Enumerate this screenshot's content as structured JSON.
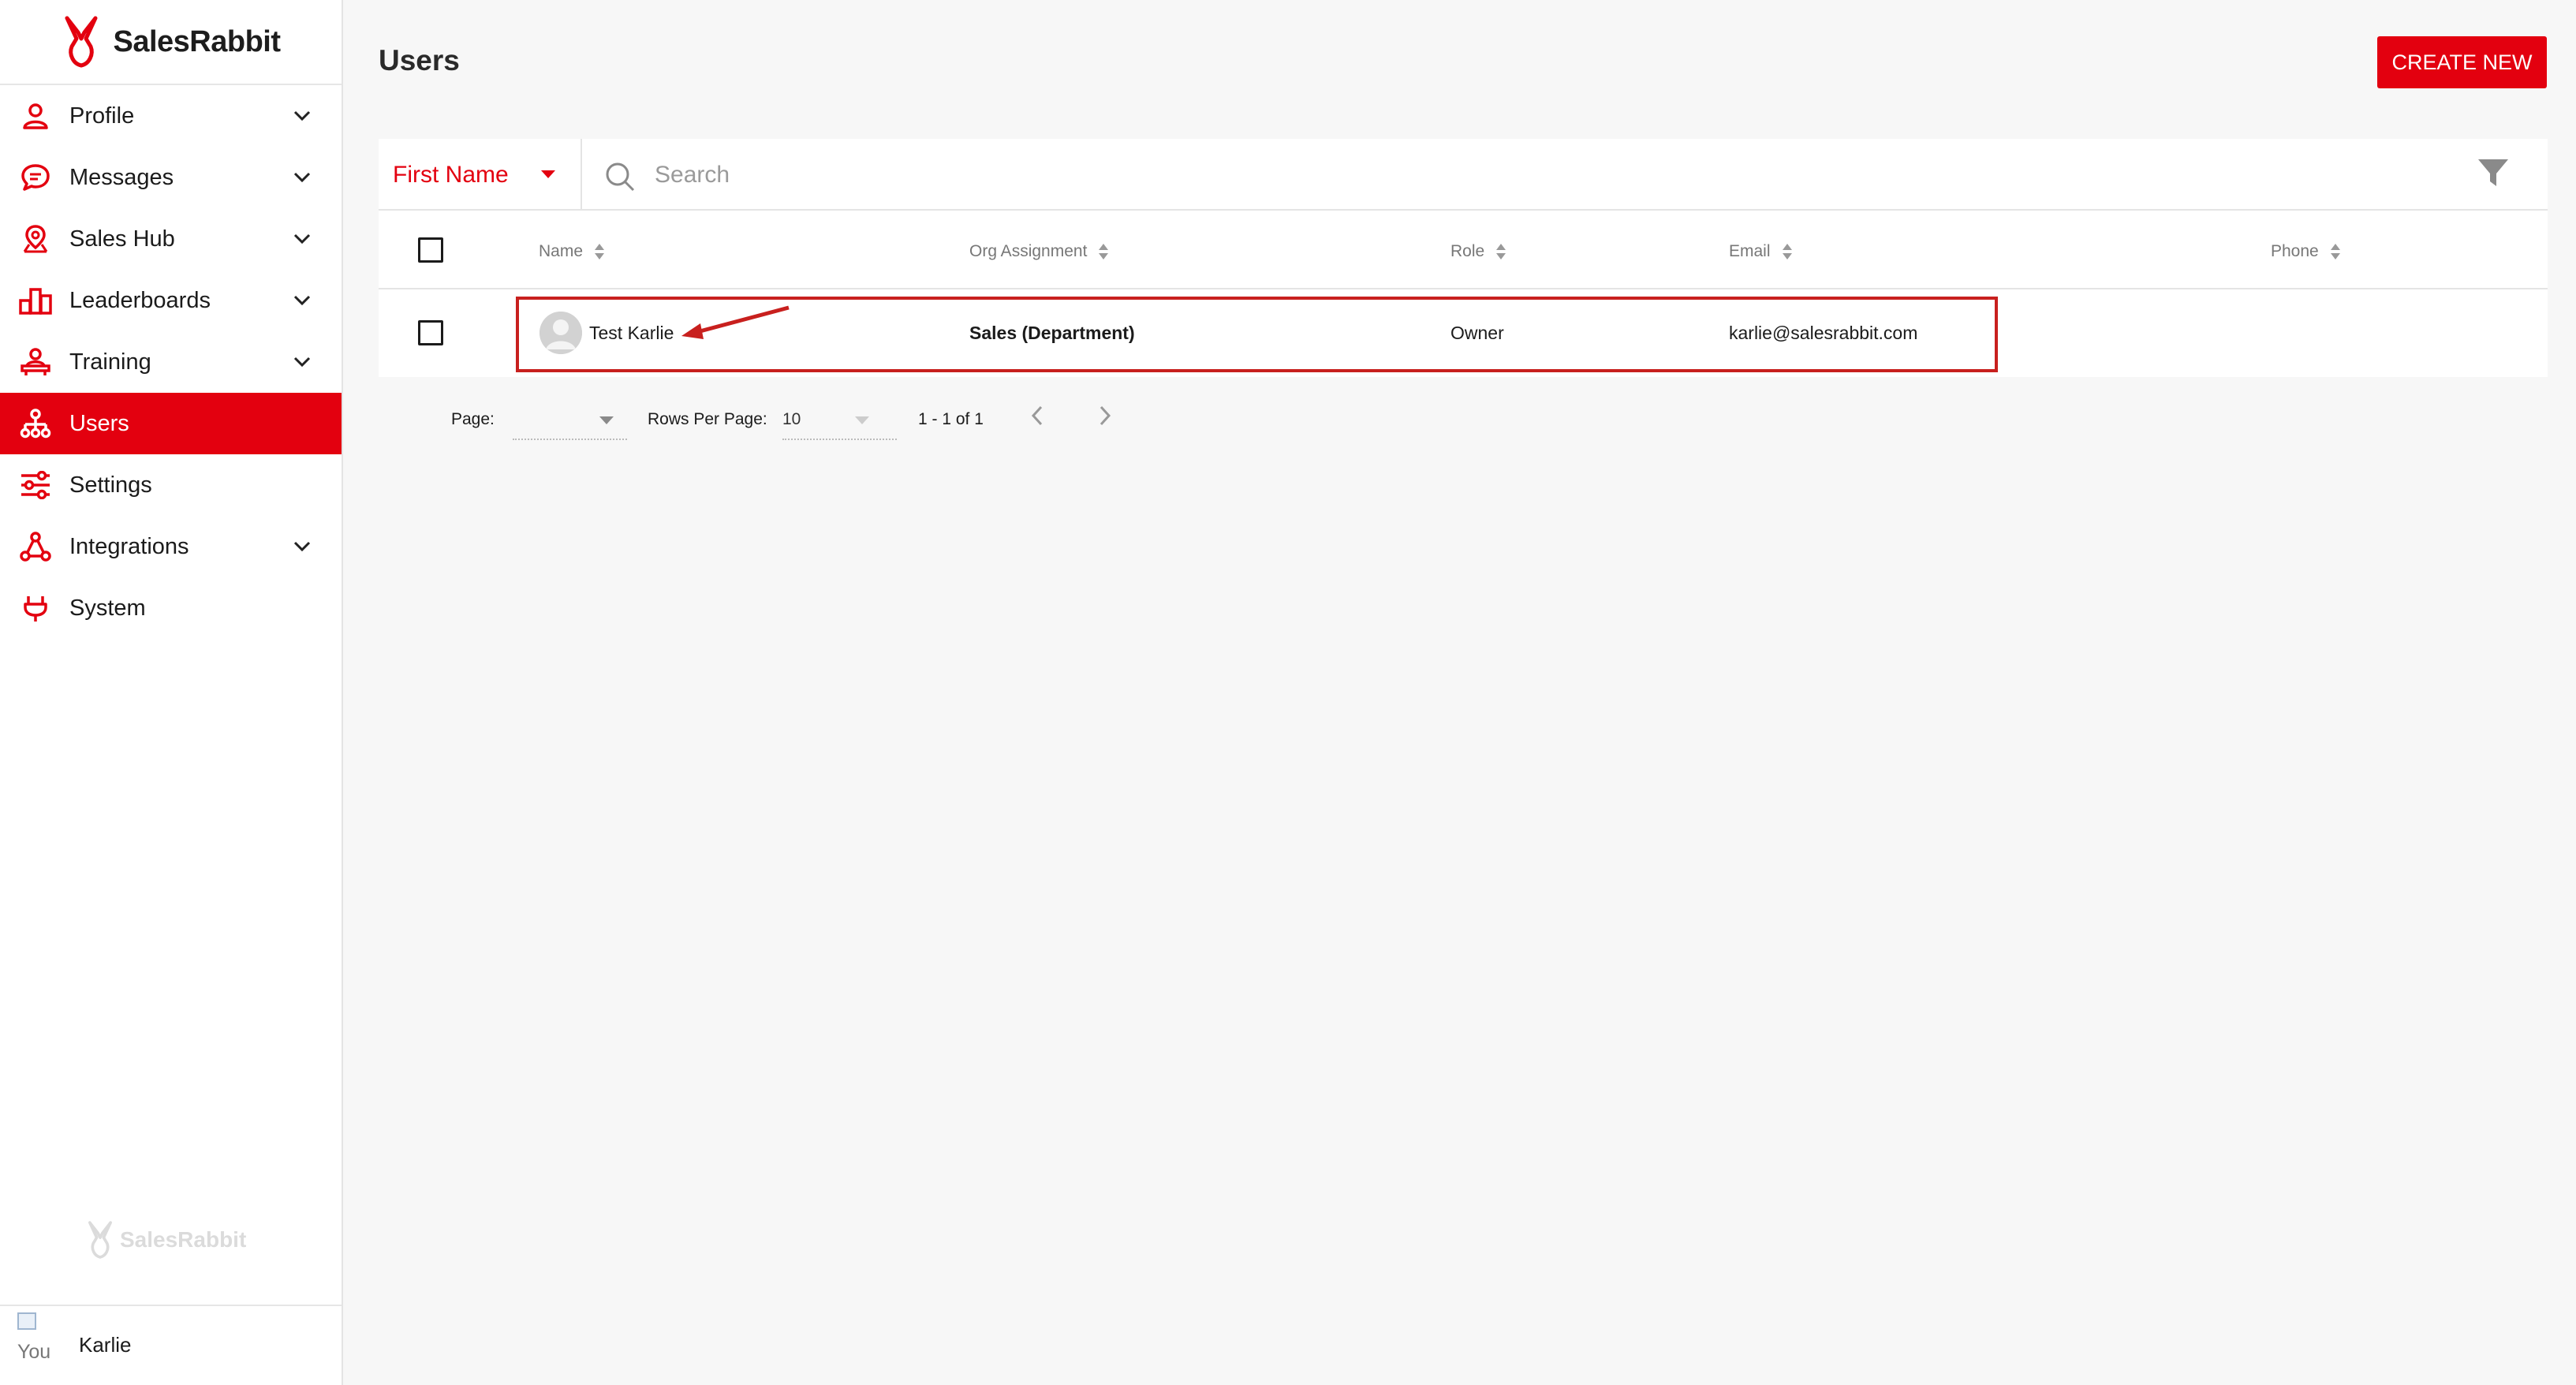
{
  "brand": {
    "name": "SalesRabbit",
    "accent": "#e3000f"
  },
  "sidebar": {
    "items": [
      {
        "label": "Profile",
        "icon": "person-icon",
        "expandable": true
      },
      {
        "label": "Messages",
        "icon": "chat-bubble-icon",
        "expandable": true
      },
      {
        "label": "Sales Hub",
        "icon": "map-pin-icon",
        "expandable": true
      },
      {
        "label": "Leaderboards",
        "icon": "podium-icon",
        "expandable": true
      },
      {
        "label": "Training",
        "icon": "presenter-icon",
        "expandable": true
      },
      {
        "label": "Users",
        "icon": "org-chart-icon",
        "expandable": false,
        "active": true
      },
      {
        "label": "Settings",
        "icon": "sliders-icon",
        "expandable": false
      },
      {
        "label": "Integrations",
        "icon": "network-icon",
        "expandable": true
      },
      {
        "label": "System",
        "icon": "plug-icon",
        "expandable": false
      }
    ],
    "footer_watermark": "SalesRabbit",
    "user": {
      "image_alt": "You",
      "name": "Karlie"
    }
  },
  "header": {
    "title": "Users",
    "create_button": "CREATE NEW"
  },
  "search": {
    "field": "First Name",
    "placeholder": "Search"
  },
  "table": {
    "columns": [
      "Name",
      "Org Assignment",
      "Role",
      "Email",
      "Phone"
    ],
    "rows": [
      {
        "name": "Test Karlie",
        "org": "Sales (Department)",
        "role": "Owner",
        "email": "karlie@salesrabbit.com",
        "phone": ""
      }
    ]
  },
  "pagination": {
    "page_label": "Page:",
    "page_value": "",
    "rows_label": "Rows Per Page:",
    "rows_value": "10",
    "range": "1 - 1 of 1"
  }
}
